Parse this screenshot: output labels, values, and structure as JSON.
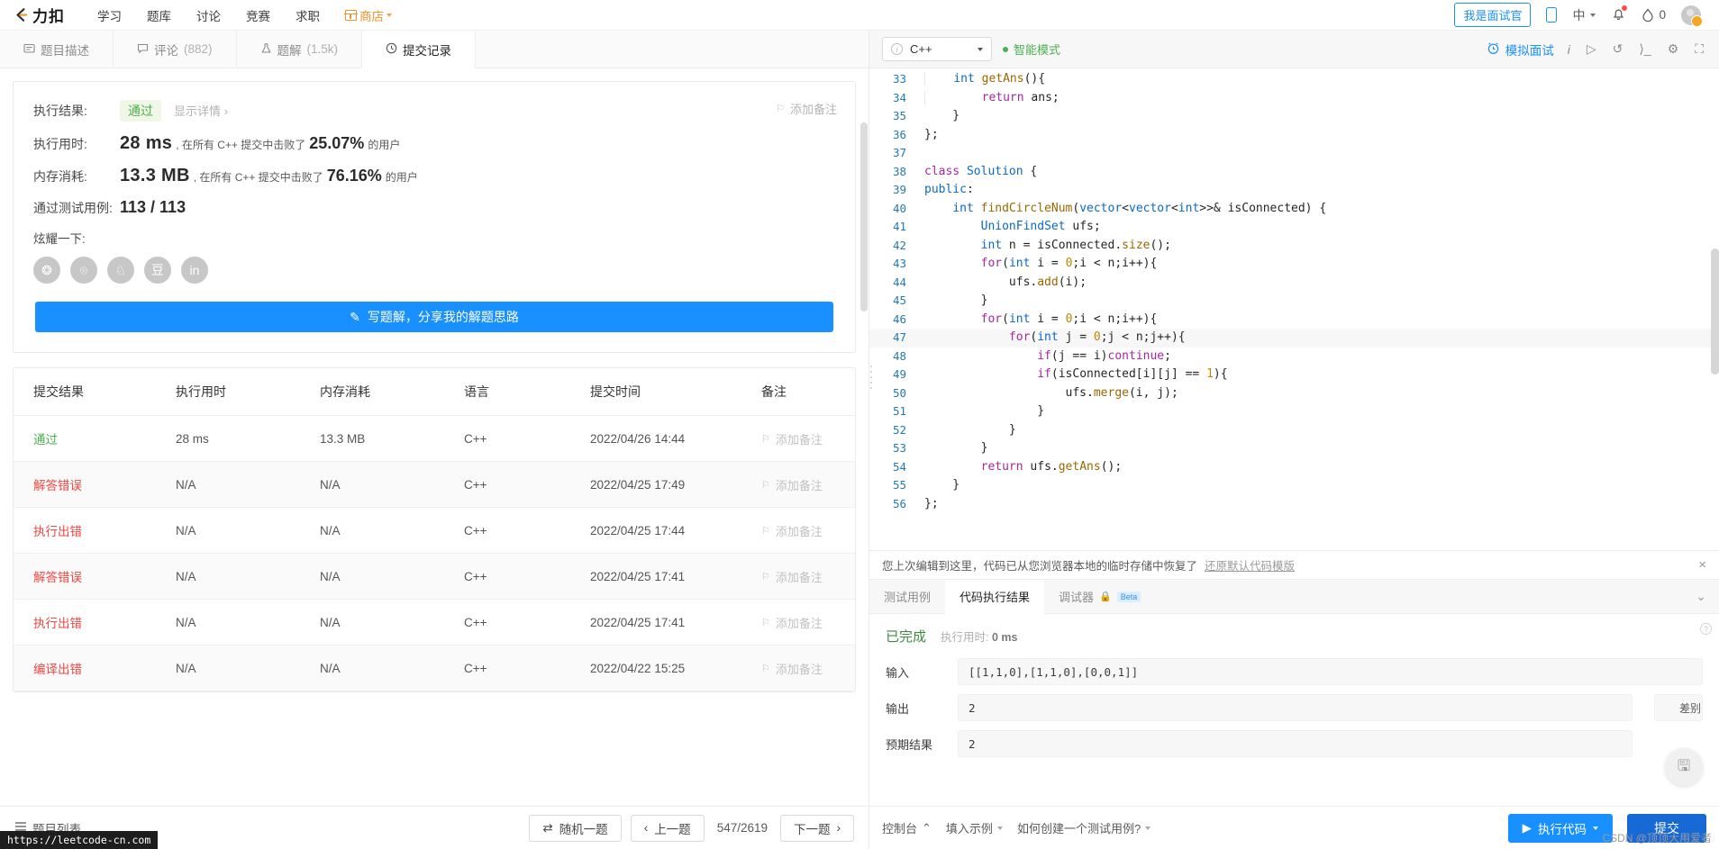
{
  "navbar": {
    "brand": "力扣",
    "links": [
      {
        "label": "学习",
        "name": "nav-study"
      },
      {
        "label": "题库",
        "name": "nav-problems"
      },
      {
        "label": "讨论",
        "name": "nav-discuss"
      },
      {
        "label": "竞赛",
        "name": "nav-contest"
      },
      {
        "label": "求职",
        "name": "nav-jobs"
      }
    ],
    "shop_label": "商店",
    "interviewer_button": "我是面试官",
    "language": "中",
    "streak_count": "0",
    "icons": {
      "mobile": "mobile-icon",
      "bell": "notification-bell-icon",
      "fire": "streak-fire-icon",
      "avatar": "user-avatar"
    }
  },
  "left_tabs": [
    {
      "label": "题目描述",
      "icon": "description-icon",
      "active": false
    },
    {
      "label": "评论",
      "count": "(882)",
      "icon": "comment-icon",
      "active": false
    },
    {
      "label": "题解",
      "count": "(1.5k)",
      "icon": "solution-flask-icon",
      "active": false
    },
    {
      "label": "提交记录",
      "count": "",
      "icon": "clock-icon",
      "active": true
    }
  ],
  "result": {
    "result_label": "执行结果:",
    "status": "通过",
    "detail_link": "显示详情",
    "runtime_label": "执行用时:",
    "runtime_value": "28 ms",
    "runtime_desc_pre": ", 在所有 C++ 提交中击败了",
    "runtime_pct": "25.07%",
    "runtime_desc_post": "的用户",
    "memory_label": "内存消耗:",
    "memory_value": "13.3 MB",
    "memory_desc_pre": ", 在所有 C++ 提交中击败了",
    "memory_pct": "76.16%",
    "memory_desc_post": "的用户",
    "cases_label": "通过测试用例:",
    "cases_value": "113 / 113",
    "share_label": "炫耀一下:",
    "share_icons": [
      {
        "name": "wechat-share-icon",
        "glyph": "❂"
      },
      {
        "name": "weibo-share-icon",
        "glyph": "⌾"
      },
      {
        "name": "qq-share-icon",
        "glyph": "♘"
      },
      {
        "name": "douban-share-icon",
        "glyph": "豆"
      },
      {
        "name": "linkedin-share-icon",
        "glyph": "in"
      }
    ],
    "cta_label": "写题解，分享我的解题思路",
    "add_note": "添加备注"
  },
  "table": {
    "headers": [
      "提交结果",
      "执行用时",
      "内存消耗",
      "语言",
      "提交时间",
      "备注"
    ],
    "rows": [
      {
        "status": "通过",
        "pass": true,
        "runtime": "28 ms",
        "memory": "13.3 MB",
        "lang": "C++",
        "date": "2022/04/26 14:44",
        "note": "添加备注"
      },
      {
        "status": "解答错误",
        "pass": false,
        "runtime": "N/A",
        "memory": "N/A",
        "lang": "C++",
        "date": "2022/04/25 17:49",
        "note": "添加备注"
      },
      {
        "status": "执行出错",
        "pass": false,
        "runtime": "N/A",
        "memory": "N/A",
        "lang": "C++",
        "date": "2022/04/25 17:44",
        "note": "添加备注"
      },
      {
        "status": "解答错误",
        "pass": false,
        "runtime": "N/A",
        "memory": "N/A",
        "lang": "C++",
        "date": "2022/04/25 17:41",
        "note": "添加备注"
      },
      {
        "status": "执行出错",
        "pass": false,
        "runtime": "N/A",
        "memory": "N/A",
        "lang": "C++",
        "date": "2022/04/25 17:41",
        "note": "添加备注"
      },
      {
        "status": "编译出错",
        "pass": false,
        "runtime": "N/A",
        "memory": "N/A",
        "lang": "C++",
        "date": "2022/04/22 15:25",
        "note": "添加备注"
      }
    ]
  },
  "left_bottom": {
    "problem_list": "题目列表",
    "random": "随机一题",
    "prev": "上一题",
    "page": "547/2619",
    "next": "下一题"
  },
  "code_toolbar": {
    "language": "C++",
    "smart_mode": "智能模式",
    "mock_interview": "模拟面试",
    "icons": [
      "info-icon",
      "play-icon",
      "reset-icon",
      "fullscreen-icon",
      "settings-icon",
      "expand-icon"
    ]
  },
  "editor": {
    "first_line": 33,
    "breakpoints": [
      47,
      55
    ],
    "breakpoints_faded": [
      55
    ],
    "highlight_line": 47,
    "lines": [
      {
        "n": 33,
        "code": "    int getAns(){"
      },
      {
        "n": 34,
        "code": "        return ans;"
      },
      {
        "n": 35,
        "code": "    }"
      },
      {
        "n": 36,
        "code": "};"
      },
      {
        "n": 37,
        "code": ""
      },
      {
        "n": 38,
        "code": "class Solution {"
      },
      {
        "n": 39,
        "code": "public:"
      },
      {
        "n": 40,
        "code": "    int findCircleNum(vector<vector<int>>& isConnected) {"
      },
      {
        "n": 41,
        "code": "        UnionFindSet ufs;"
      },
      {
        "n": 42,
        "code": "        int n = isConnected.size();"
      },
      {
        "n": 43,
        "code": "        for(int i = 0;i < n;i++){"
      },
      {
        "n": 44,
        "code": "            ufs.add(i);"
      },
      {
        "n": 45,
        "code": "        }"
      },
      {
        "n": 46,
        "code": "        for(int i = 0;i < n;i++){"
      },
      {
        "n": 47,
        "code": "            for(int j = 0;j < n;j++){"
      },
      {
        "n": 48,
        "code": "                if(j == i)continue;"
      },
      {
        "n": 49,
        "code": "                if(isConnected[i][j] == 1){"
      },
      {
        "n": 50,
        "code": "                    ufs.merge(i, j);"
      },
      {
        "n": 51,
        "code": "                }"
      },
      {
        "n": 52,
        "code": "            }"
      },
      {
        "n": 53,
        "code": "        }"
      },
      {
        "n": 54,
        "code": "        return ufs.getAns();"
      },
      {
        "n": 55,
        "code": "    }"
      },
      {
        "n": 56,
        "code": "};"
      }
    ]
  },
  "notice": {
    "text": "您上次编辑到这里，代码已从您浏览器本地的临时存储中恢复了",
    "link": "还原默认代码模版",
    "close": "×"
  },
  "console": {
    "tabs": [
      {
        "label": "测试用例",
        "active": false
      },
      {
        "label": "代码执行结果",
        "active": true
      },
      {
        "label": "调试器",
        "active": false,
        "badge": "Beta",
        "lock": "lock-icon"
      }
    ],
    "status": "已完成",
    "elapsed_label": "执行用时:",
    "elapsed_value": "0 ms",
    "input_label": "输入",
    "input_value": "[[1,1,0],[1,1,0],[0,0,1]]",
    "output_label": "输出",
    "output_value": "2",
    "expected_label": "预期结果",
    "expected_value": "2",
    "diff_label": "差别",
    "fab_icon": "save-icon"
  },
  "right_bottom": {
    "console_label": "控制台",
    "fill_example": "填入示例",
    "how_to": "如何创建一个测试用例?",
    "run_label": "执行代码",
    "submit_label": "提交"
  },
  "watermarks": {
    "left": "https://leetcode-cn.com",
    "right": "CSDN @顶顶大用爱者"
  },
  "colors": {
    "accent": "#1890ff",
    "submit": "#1769d6",
    "pass": "#4caf50",
    "fail": "#ef4743",
    "shop": "#f0932b"
  }
}
